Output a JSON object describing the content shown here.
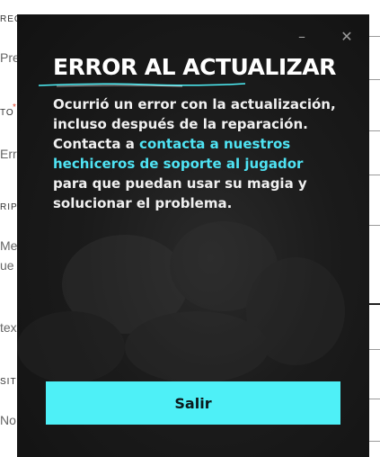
{
  "background": {
    "fragments": [
      "RECO",
      "Pre",
      "TO",
      "*",
      "Err",
      "RIPC",
      "Me",
      "ue",
      "tex",
      "SIT",
      "No"
    ]
  },
  "modal": {
    "minimize_label": "–",
    "close_label": "✕",
    "title": "ERROR AL ACTUALIZAR",
    "message_part1": "Ocurrió un error con la actualización, incluso después de la reparación. Contacta a ",
    "link_text": "contacta a nuestros hechiceros de soporte al jugador",
    "message_part2": " para que puedan usar su magia y solucionar el problema.",
    "exit_label": "Salir"
  },
  "colors": {
    "accent": "#4ef0f7",
    "link": "#4fe3f3",
    "modal_bg": "#1b1b1b",
    "required": "#e0452c"
  },
  "icons": [
    "minimize-icon",
    "close-icon"
  ]
}
